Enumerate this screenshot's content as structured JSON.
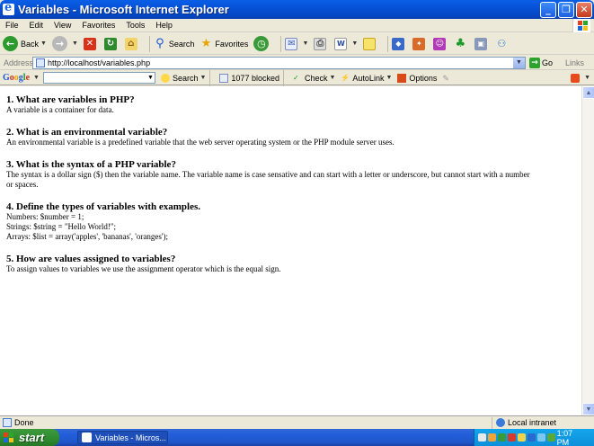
{
  "window": {
    "title": "Variables - Microsoft Internet Explorer"
  },
  "menu": [
    "File",
    "Edit",
    "View",
    "Favorites",
    "Tools",
    "Help"
  ],
  "toolbar": {
    "back_label": "Back",
    "search_label": "Search",
    "favorites_label": "Favorites"
  },
  "address": {
    "label": "Address",
    "url": "http://localhost/variables.php",
    "go_label": "Go",
    "links_label": "Links"
  },
  "googlebar": {
    "logo": [
      "G",
      "o",
      "o",
      "g",
      "l",
      "e"
    ],
    "search_label": "Search",
    "blocked_label": "1077 blocked",
    "check_label": "Check",
    "autolink_label": "AutoLink",
    "options_label": "Options"
  },
  "content": {
    "sections": [
      {
        "title": "1. What are variables in PHP?",
        "lines": [
          "A variable is a container for data."
        ]
      },
      {
        "title": "2. What is an environmental variable?",
        "lines": [
          "An environmental variable is a predefined variable that the web server operating system or the PHP module server uses."
        ]
      },
      {
        "title": "3. What is the syntax of a PHP variable?",
        "lines": [
          "The syntax is a dollar sign ($) then the variable name. The variable name is case sensative and can start with a letter or underscore, but cannot start with a number",
          "or spaces."
        ]
      },
      {
        "title": "4. Define the types of variables with examples.",
        "lines": [
          "Numbers: $number = 1;",
          "Strings: $string = \"Hello World!\";",
          "Arrays: $list = array('apples', 'bananas', 'oranges');"
        ]
      },
      {
        "title": "5. How are values assigned to variables?",
        "lines": [
          "To assign values to variables we use the assignment operator which is the equal sign."
        ]
      }
    ]
  },
  "status": {
    "text": "Done",
    "zone": "Local intranet"
  },
  "taskbar": {
    "start_label": "start",
    "task_label": "Variables - Micros...",
    "clock": "1:07 PM"
  },
  "colors": {
    "titlebar": "#0a5fe6",
    "taskbar": "#245edb",
    "start": "#2f8a2f",
    "tray": "#0d8fd9"
  }
}
